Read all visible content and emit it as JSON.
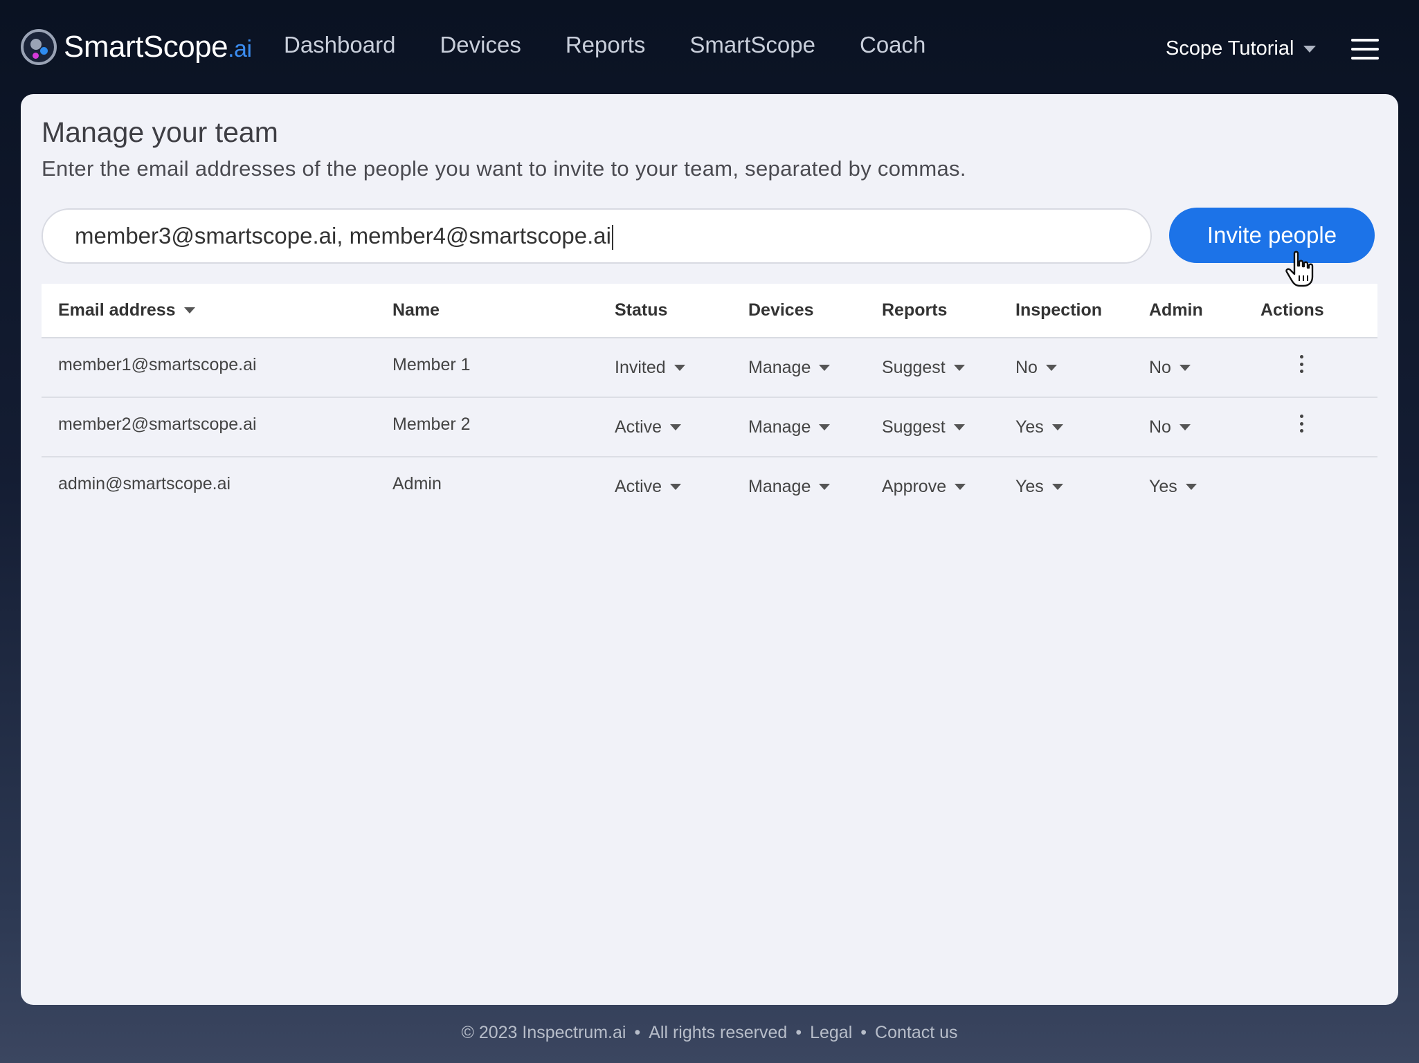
{
  "nav": {
    "logo_main": "SmartScope",
    "logo_suffix": ".ai",
    "links": [
      "Dashboard",
      "Devices",
      "Reports",
      "SmartScope",
      "Coach"
    ],
    "account": "Scope Tutorial"
  },
  "main": {
    "title": "Manage your team",
    "subtitle": "Enter the email addresses of the people you want to invite to your team, separated by commas.",
    "invite_value": "member3@smartscope.ai, member4@smartscope.ai",
    "invite_button": "Invite people"
  },
  "table": {
    "columns": [
      "Email address",
      "Name",
      "Status",
      "Devices",
      "Reports",
      "Inspection",
      "Admin",
      "Actions"
    ],
    "rows": [
      {
        "email": "member1@smartscope.ai",
        "name": "Member 1",
        "status": "Invited",
        "devices": "Manage",
        "reports": "Suggest",
        "inspection": "No",
        "admin": "No"
      },
      {
        "email": "member2@smartscope.ai",
        "name": "Member 2",
        "status": "Active",
        "devices": "Manage",
        "reports": "Suggest",
        "inspection": "Yes",
        "admin": "No"
      },
      {
        "email": "admin@smartscope.ai",
        "name": "Admin",
        "status": "Active",
        "devices": "Manage",
        "reports": "Approve",
        "inspection": "Yes",
        "admin": "Yes"
      }
    ]
  },
  "footer": {
    "copyright": "© 2023 Inspectrum.ai",
    "rights": "All rights reserved",
    "legal": "Legal",
    "contact": "Contact us"
  }
}
